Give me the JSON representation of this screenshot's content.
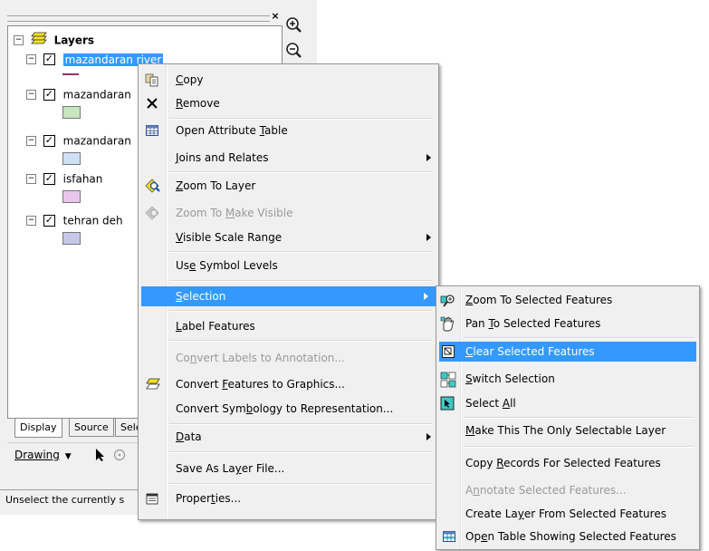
{
  "toc": {
    "root_label": "Layers",
    "layers": [
      {
        "label": "mazandaran river",
        "checked": true,
        "selected": true,
        "symbol": "line",
        "color": "#9b2d6a"
      },
      {
        "label": "mazandaran",
        "checked": true,
        "selected": false,
        "symbol": "fill",
        "color": "#c8e6c0"
      },
      {
        "label": "mazandaran",
        "checked": true,
        "selected": false,
        "symbol": "fill",
        "color": "#cfe0f4"
      },
      {
        "label": "isfahan",
        "checked": true,
        "selected": false,
        "symbol": "fill",
        "color": "#e9c7ec"
      },
      {
        "label": "tehran deh",
        "checked": true,
        "selected": false,
        "symbol": "fill",
        "color": "#c6c8ea"
      }
    ],
    "tabs": [
      "Display",
      "Source",
      "Sele"
    ],
    "close_glyph": "×"
  },
  "drawing_toolbar": {
    "label": "Drawing",
    "dropdown_glyph": "▼"
  },
  "statusbar": {
    "text": "Unselect the currently s"
  },
  "context_menu": {
    "items": [
      {
        "pre": "",
        "u": "C",
        "post": "opy",
        "icon": "copy-icon"
      },
      {
        "pre": "",
        "u": "R",
        "post": "emove",
        "icon": "remove-icon"
      },
      {
        "pre": "Open Attribute ",
        "u": "T",
        "post": "able",
        "icon": "attribute-table-icon"
      },
      {
        "pre": "",
        "u": "J",
        "post": "oins and Relates",
        "submenu": true
      },
      {
        "pre": "",
        "u": "Z",
        "post": "oom To Layer",
        "icon": "zoom-to-layer-icon"
      },
      {
        "pre": "Zoom To ",
        "u": "M",
        "post": "ake Visible",
        "icon": "zoom-make-visible-icon",
        "disabled": true
      },
      {
        "pre": "",
        "u": "V",
        "post": "isible Scale Range",
        "submenu": true
      },
      {
        "pre": "Us",
        "u": "e",
        "post": " Symbol Levels"
      },
      {
        "pre": "",
        "u": "S",
        "post": "election",
        "submenu": true,
        "highlighted": true
      },
      {
        "pre": "",
        "u": "L",
        "post": "abel Features"
      },
      {
        "pre": "Co",
        "u": "n",
        "post": "vert Labels to Annotation...",
        "disabled": true
      },
      {
        "pre": "Convert ",
        "u": "F",
        "post": "eatures to Graphics...",
        "icon": "convert-graphics-icon"
      },
      {
        "pre": "Convert Sym",
        "u": "b",
        "post": "ology to Representation..."
      },
      {
        "pre": "",
        "u": "D",
        "post": "ata",
        "submenu": true
      },
      {
        "pre": "Save As La",
        "u": "y",
        "post": "er File..."
      },
      {
        "pre": "Proper",
        "u": "t",
        "post": "ies...",
        "icon": "properties-icon"
      }
    ]
  },
  "selection_submenu": {
    "items": [
      {
        "pre": "",
        "u": "Z",
        "post": "oom To Selected Features",
        "icon": "zoom-selected-icon"
      },
      {
        "pre": "Pan ",
        "u": "T",
        "post": "o Selected Features",
        "icon": "pan-selected-icon"
      },
      {
        "pre": "",
        "u": "C",
        "post": "lear Selected Features",
        "icon": "clear-selection-icon",
        "highlighted": true
      },
      {
        "pre": "",
        "u": "S",
        "post": "witch Selection",
        "icon": "switch-selection-icon"
      },
      {
        "pre": "Select ",
        "u": "A",
        "post": "ll",
        "icon": "select-all-icon"
      },
      {
        "pre": "",
        "u": "M",
        "post": "ake This The Only Selectable Layer"
      },
      {
        "pre": "Copy ",
        "u": "R",
        "post": "ecords For Selected Features"
      },
      {
        "pre": "A",
        "u": "n",
        "post": "notate Selected Features...",
        "disabled": true
      },
      {
        "pre": "Create La",
        "u": "y",
        "post": "er From Selected Features"
      },
      {
        "pre": "Op",
        "u": "e",
        "post": "n Table Showing Selected Features",
        "icon": "open-table-icon"
      }
    ]
  },
  "colors": {
    "highlight": "#3399ff",
    "menu_bg": "#f0f0f0"
  }
}
